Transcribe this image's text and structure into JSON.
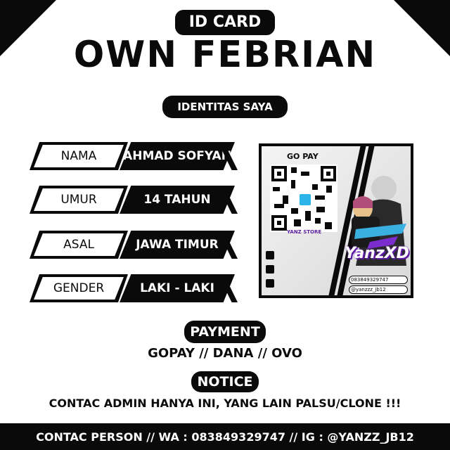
{
  "header": {
    "badge": "ID CARD",
    "name": "OWN FEBRIAN",
    "section": "IDENTITAS SAYA"
  },
  "identity": [
    {
      "label": "NAMA",
      "value": "AHMAD SOFYAN"
    },
    {
      "label": "UMUR",
      "value": "14 TAHUN"
    },
    {
      "label": "ASAL",
      "value": "JAWA TIMUR"
    },
    {
      "label": "GENDER",
      "value": "LAKI - LAKI"
    }
  ],
  "promo": {
    "gopay_label": "GO PAY",
    "brand": "YanzXD",
    "store": "YANZ STORE",
    "phone": "083849329747",
    "ig": "@yanzzz_jb12",
    "colors": {
      "brand_purple": "#7a2ccc",
      "qr_logo": "#2ab4e8"
    }
  },
  "payment": {
    "title": "PAYMENT",
    "methods": "GOPAY // DANA // OVO"
  },
  "notice": {
    "title": "NOTICE",
    "text": "CONTAC ADMIN HANYA INI, YANG LAIN PALSU/CLONE !!!"
  },
  "footer": {
    "contact": "CONTAC PERSON // WA : 083849329747 // IG : @YANZZ_JB12"
  },
  "colors": {
    "ink": "#0a0a0a",
    "paper": "#ffffff"
  }
}
